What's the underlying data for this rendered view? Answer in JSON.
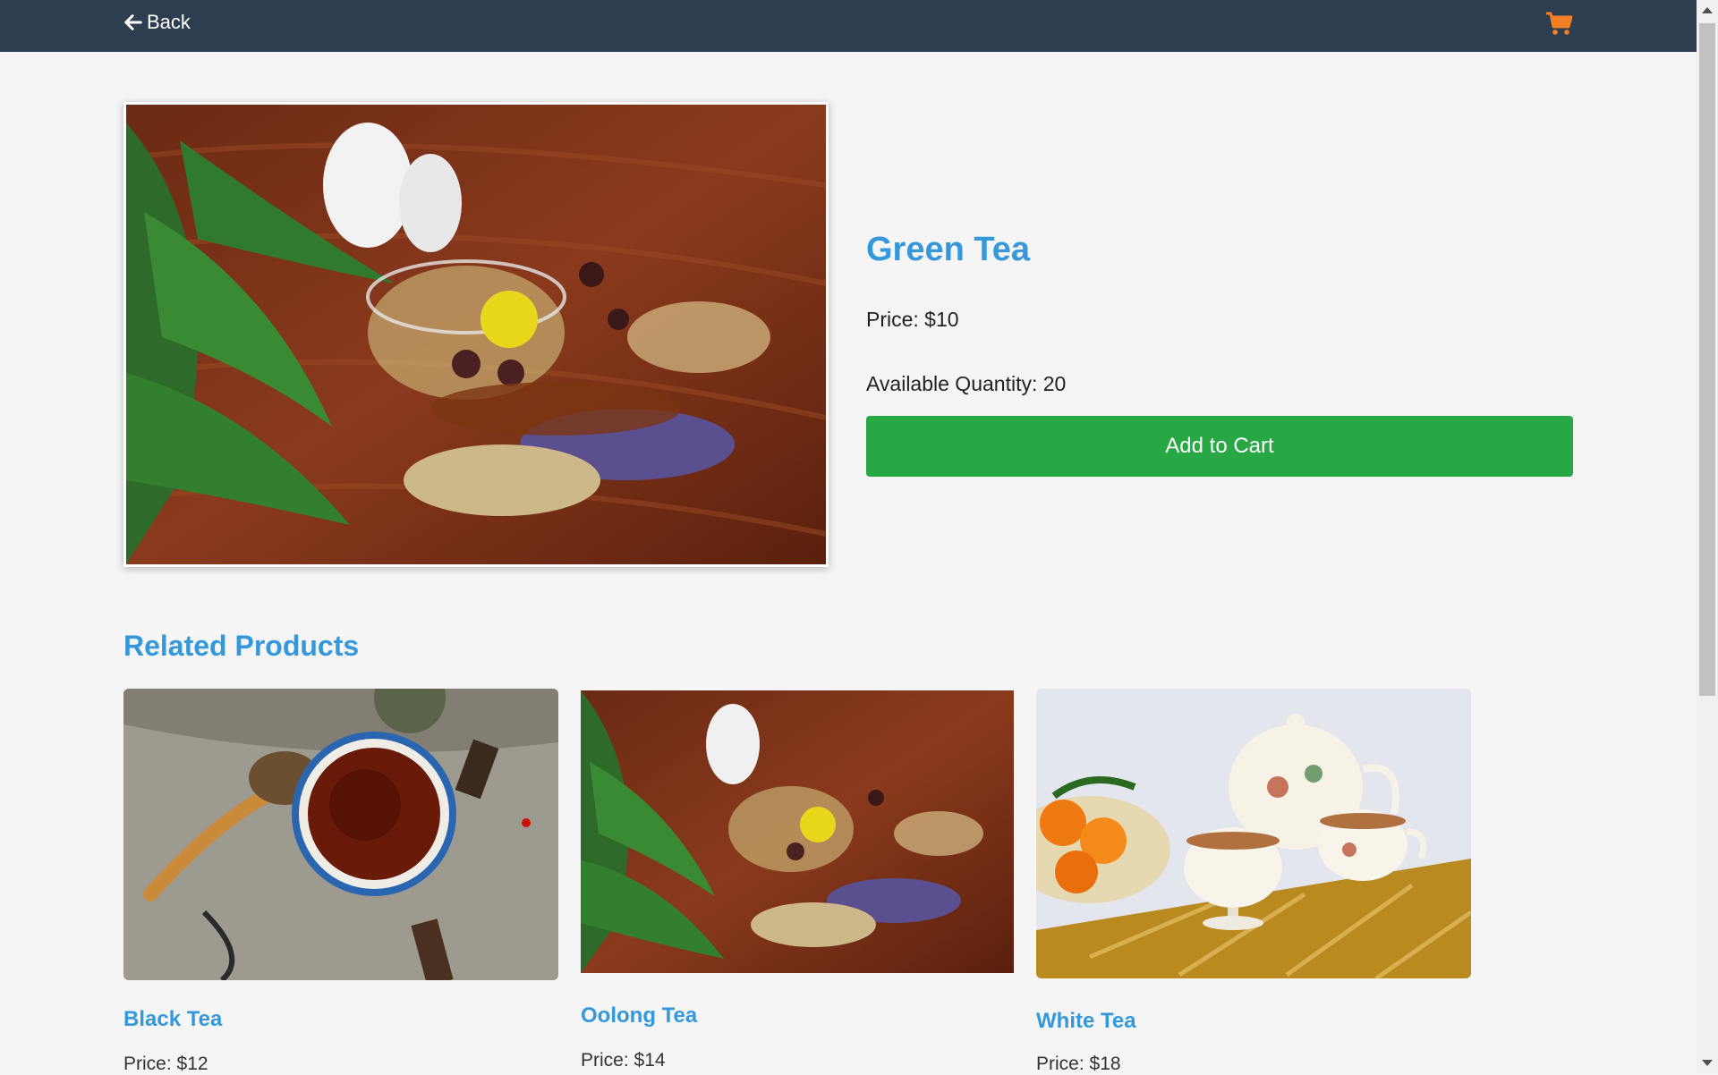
{
  "nav": {
    "back_label": "Back",
    "cart_icon": "shopping-cart-icon",
    "cart_color": "#f48024"
  },
  "product": {
    "name": "Green Tea",
    "price": "Price: $10",
    "quantity": "Available Quantity: 20",
    "add_to_cart_label": "Add to Cart"
  },
  "related": {
    "heading": "Related Products",
    "items": [
      {
        "name": "Black Tea",
        "price": "Price: $12"
      },
      {
        "name": "Oolong Tea",
        "price": "Price: $14"
      },
      {
        "name": "White Tea",
        "price": "Price: $18"
      }
    ]
  },
  "colors": {
    "header_bg": "#2c3e50",
    "accent": "#3498db",
    "button_green": "#28a745"
  }
}
